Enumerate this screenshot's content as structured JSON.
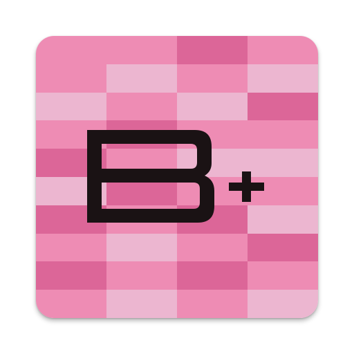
{
  "app_icon": {
    "name": "B+",
    "logo_letter": "B",
    "logo_symbol": "+",
    "colors": {
      "dark_pink": "#dc6698",
      "mid_pink": "#ee8cb4",
      "light_pink": "#ecb6d0",
      "glyph": "#1a1214"
    },
    "tile_pattern": [
      [
        "mid_pink",
        "mid_pink",
        "dark_pink",
        "mid_pink"
      ],
      [
        "mid_pink",
        "light_pink",
        "mid_pink",
        "light_pink"
      ],
      [
        "light_pink",
        "mid_pink",
        "light_pink",
        "dark_pink"
      ],
      [
        "mid_pink",
        "dark_pink",
        "mid_pink",
        "mid_pink"
      ],
      [
        "dark_pink",
        "mid_pink",
        "light_pink",
        "light_pink"
      ],
      [
        "light_pink",
        "dark_pink",
        "mid_pink",
        "mid_pink"
      ],
      [
        "dark_pink",
        "mid_pink",
        "dark_pink",
        "light_pink"
      ],
      [
        "mid_pink",
        "light_pink",
        "mid_pink",
        "dark_pink"
      ],
      [
        "dark_pink",
        "mid_pink",
        "dark_pink",
        "mid_pink"
      ],
      [
        "mid_pink",
        "light_pink",
        "mid_pink",
        "light_pink"
      ]
    ]
  }
}
